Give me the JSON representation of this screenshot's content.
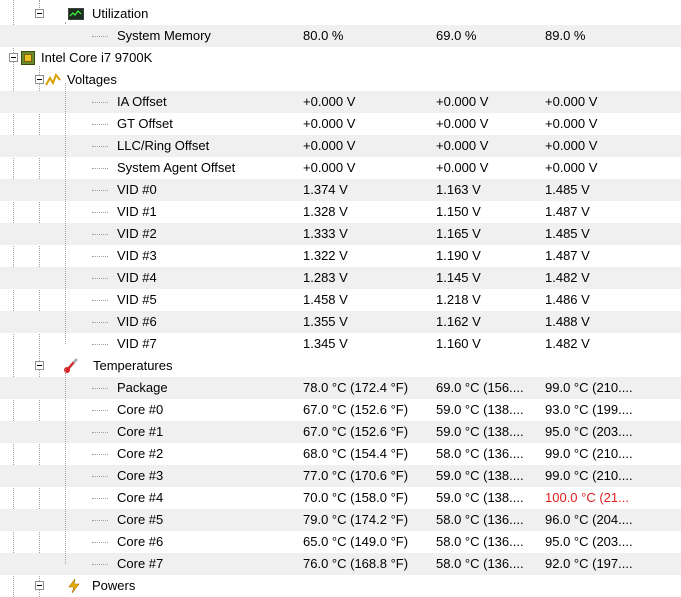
{
  "tree": {
    "utilization_group": {
      "label": "Utilization",
      "rows": [
        {
          "label": "System Memory",
          "current": "80.0 %",
          "min": "69.0 %",
          "max": "89.0 %"
        }
      ]
    },
    "cpu": {
      "label": "Intel Core i7 9700K",
      "voltages": {
        "label": "Voltages",
        "rows": [
          {
            "label": "IA Offset",
            "current": "+0.000 V",
            "min": "+0.000 V",
            "max": "+0.000 V"
          },
          {
            "label": "GT Offset",
            "current": "+0.000 V",
            "min": "+0.000 V",
            "max": "+0.000 V"
          },
          {
            "label": "LLC/Ring Offset",
            "current": "+0.000 V",
            "min": "+0.000 V",
            "max": "+0.000 V"
          },
          {
            "label": "System Agent Offset",
            "current": "+0.000 V",
            "min": "+0.000 V",
            "max": "+0.000 V"
          },
          {
            "label": "VID #0",
            "current": "1.374 V",
            "min": "1.163 V",
            "max": "1.485 V"
          },
          {
            "label": "VID #1",
            "current": "1.328 V",
            "min": "1.150 V",
            "max": "1.487 V"
          },
          {
            "label": "VID #2",
            "current": "1.333 V",
            "min": "1.165 V",
            "max": "1.485 V"
          },
          {
            "label": "VID #3",
            "current": "1.322 V",
            "min": "1.190 V",
            "max": "1.487 V"
          },
          {
            "label": "VID #4",
            "current": "1.283 V",
            "min": "1.145 V",
            "max": "1.482 V"
          },
          {
            "label": "VID #5",
            "current": "1.458 V",
            "min": "1.218 V",
            "max": "1.486 V"
          },
          {
            "label": "VID #6",
            "current": "1.355 V",
            "min": "1.162 V",
            "max": "1.488 V"
          },
          {
            "label": "VID #7",
            "current": "1.345 V",
            "min": "1.160 V",
            "max": "1.482 V"
          }
        ]
      },
      "temperatures": {
        "label": "Temperatures",
        "rows": [
          {
            "label": "Package",
            "current": "78.0 °C  (172.4 °F)",
            "min": "69.0 °C  (156....",
            "max": "99.0 °C  (210...."
          },
          {
            "label": "Core #0",
            "current": "67.0 °C  (152.6 °F)",
            "min": "59.0 °C  (138....",
            "max": "93.0 °C  (199...."
          },
          {
            "label": "Core #1",
            "current": "67.0 °C  (152.6 °F)",
            "min": "59.0 °C  (138....",
            "max": "95.0 °C  (203...."
          },
          {
            "label": "Core #2",
            "current": "68.0 °C  (154.4 °F)",
            "min": "58.0 °C  (136....",
            "max": "99.0 °C  (210...."
          },
          {
            "label": "Core #3",
            "current": "77.0 °C  (170.6 °F)",
            "min": "59.0 °C  (138....",
            "max": "99.0 °C  (210...."
          },
          {
            "label": "Core #4",
            "current": "70.0 °C  (158.0 °F)",
            "min": "59.0 °C  (138....",
            "max": "100.0 °C  (21...",
            "max_color": "#e02020"
          },
          {
            "label": "Core #5",
            "current": "79.0 °C  (174.2 °F)",
            "min": "58.0 °C  (136....",
            "max": "96.0 °C  (204...."
          },
          {
            "label": "Core #6",
            "current": "65.0 °C  (149.0 °F)",
            "min": "58.0 °C  (136....",
            "max": "95.0 °C  (203...."
          },
          {
            "label": "Core #7",
            "current": "76.0 °C  (168.8 °F)",
            "min": "58.0 °C  (136....",
            "max": "92.0 °C  (197...."
          }
        ]
      },
      "powers": {
        "label": "Powers"
      }
    }
  },
  "colors": {
    "alert": "#e02020",
    "alt_row": "#f0f0f0"
  },
  "icons": {
    "utilization": "chart-icon",
    "cpu": "chip-icon",
    "voltages": "voltage-icon",
    "temperatures": "thermometer-icon",
    "powers": "power-icon"
  }
}
